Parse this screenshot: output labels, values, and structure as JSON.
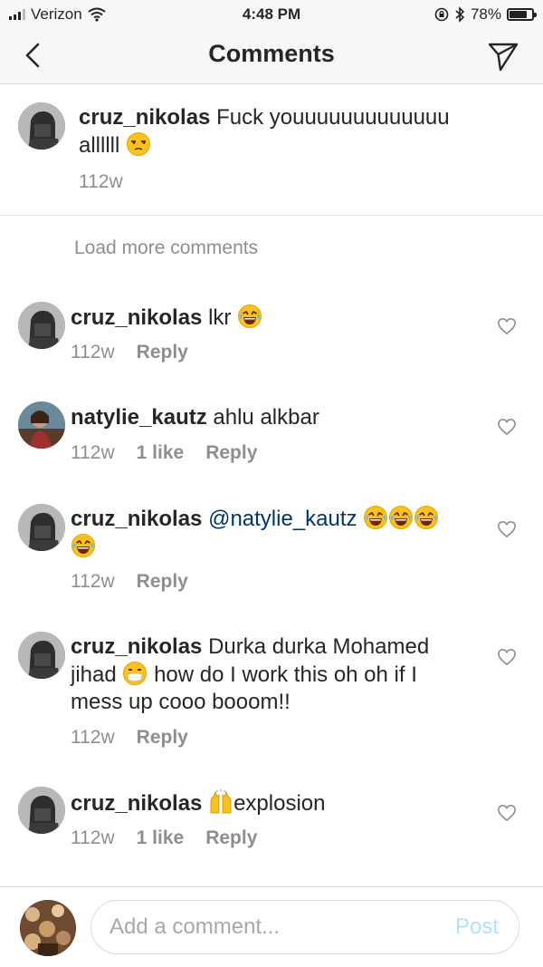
{
  "status_bar": {
    "carrier": "Verizon",
    "time": "4:48 PM",
    "battery": "78%",
    "battery_level": 0.78
  },
  "nav": {
    "title": "Comments"
  },
  "caption": {
    "username": "cruz_nikolas",
    "text": "Fuck youuuuuuuuuuuuu allllll",
    "emoji": "unamused-face",
    "time": "112w"
  },
  "load_more": "Load more comments",
  "comments": [
    {
      "username": "cruz_nikolas",
      "text": "lkr",
      "time": "112w",
      "likes": "",
      "reply": "Reply"
    },
    {
      "username": "natylie_kautz",
      "text": "ahlu alkbar",
      "time": "112w",
      "likes": "1 like",
      "reply": "Reply"
    },
    {
      "username": "cruz_nikolas",
      "mention": "@natylie_kautz",
      "time": "112w",
      "likes": "",
      "reply": "Reply"
    },
    {
      "username": "cruz_nikolas",
      "text_a": "Durka durka Mohamed",
      "text_b": "jihad",
      "text_c": "how do I work this oh oh if I",
      "text_d": "mess up  cooo booom!!",
      "time": "112w",
      "likes": "",
      "reply": "Reply"
    },
    {
      "username": "cruz_nikolas",
      "text": "explosion",
      "time": "112w",
      "likes": "1 like",
      "reply": "Reply"
    }
  ],
  "composer": {
    "placeholder": "Add a comment...",
    "post_label": "Post"
  },
  "colors": {
    "accent_disabled": "#b2dffc",
    "mention": "#003569",
    "muted": "#8e8e8e"
  }
}
